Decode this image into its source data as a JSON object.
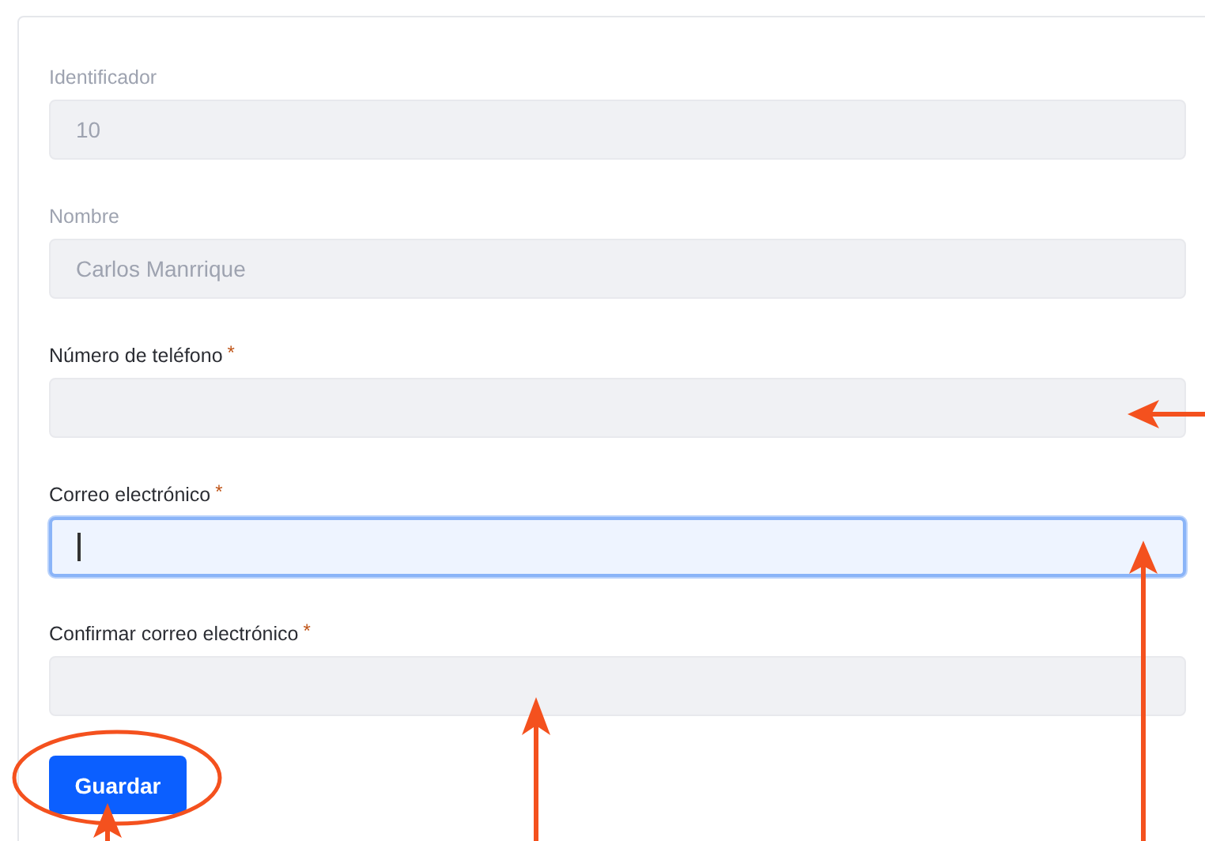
{
  "form": {
    "fields": [
      {
        "label": "Identificador",
        "value": "10",
        "disabled": true,
        "focused": false
      },
      {
        "label": "Nombre",
        "value": "Carlos Manrrique",
        "disabled": true,
        "focused": false
      },
      {
        "label": "Número de teléfono",
        "required_mark": "*",
        "disabled": false,
        "focused": false
      },
      {
        "label": "Correo electrónico",
        "required_mark": "*",
        "disabled": false,
        "focused": true
      },
      {
        "label": "Confirmar correo electrónico",
        "required_mark": "*",
        "disabled": false,
        "focused": false
      }
    ],
    "submit_button": "Guardar"
  }
}
